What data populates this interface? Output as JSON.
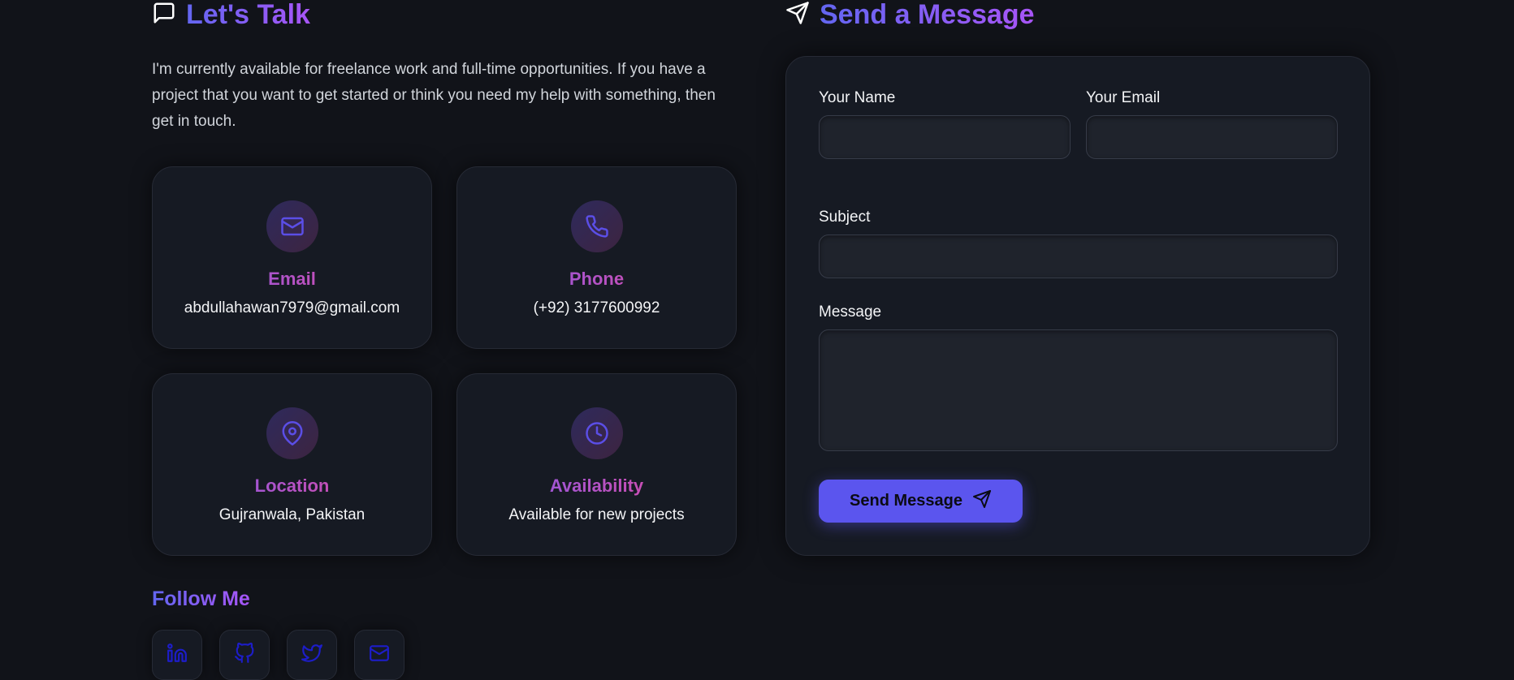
{
  "contact": {
    "title": "Let's Talk",
    "intro": "I'm currently available for freelance work and full-time opportunities. If you have a project that you want to get started or think you need my help with something, then get in touch.",
    "cards": [
      {
        "icon": "mail-icon",
        "title": "Email",
        "value": "abdullahawan7979@gmail.com"
      },
      {
        "icon": "phone-icon",
        "title": "Phone",
        "value": "(+92) 3177600992"
      },
      {
        "icon": "map-pin-icon",
        "title": "Location",
        "value": "Gujranwala, Pakistan"
      },
      {
        "icon": "clock-icon",
        "title": "Availability",
        "value": "Available for new projects"
      }
    ],
    "follow_title": "Follow Me",
    "socials": [
      "linkedin-icon",
      "github-icon",
      "twitter-icon",
      "mail-icon"
    ]
  },
  "form": {
    "title": "Send a Message",
    "name_label": "Your Name",
    "name_value": "",
    "email_label": "Your Email",
    "email_value": "",
    "subject_label": "Subject",
    "subject_value": "",
    "message_label": "Message",
    "message_value": "",
    "submit_label": "Send Message"
  },
  "colors": {
    "background": "#111319",
    "card": "#161a23",
    "accent": "#5b55ee",
    "icon_accent": "#5b4ee6",
    "social_icon": "#1d1dc9"
  }
}
